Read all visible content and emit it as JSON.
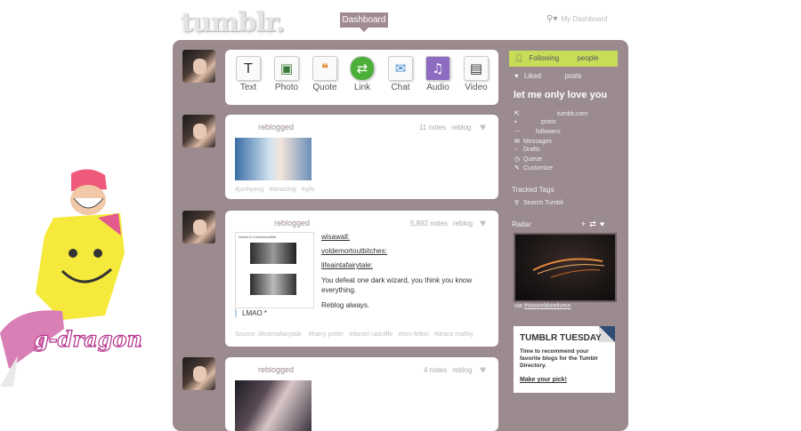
{
  "header": {
    "logo": "tumblr.",
    "nav_dashboard": "Dashboard",
    "search_label": "My Dashboard",
    "search_icon": "search-icon"
  },
  "decoration": {
    "signature_text": "g-dragon"
  },
  "composer": {
    "types": [
      {
        "label": "Text",
        "icon": "T"
      },
      {
        "label": "Photo",
        "icon": "▣"
      },
      {
        "label": "Quote",
        "icon": "❝"
      },
      {
        "label": "Link",
        "icon": "⇄"
      },
      {
        "label": "Chat",
        "icon": "✉"
      },
      {
        "label": "Audio",
        "icon": "♫"
      },
      {
        "label": "Video",
        "icon": "▤"
      }
    ]
  },
  "posts": [
    {
      "status": "reblogged",
      "notes": "11 notes",
      "reblog": "reblog",
      "tags": [
        "#junhyung",
        "#amazing",
        "#gifs"
      ]
    },
    {
      "status": "reblogged",
      "notes": "5,892 notes",
      "reblog": "reblog",
      "thumb_caption": "Daniel in Cinemacotebit",
      "chain": [
        "wisawall:",
        "voldemortoutbitches:",
        "lifeaintafairytale:"
      ],
      "quote": "You defeat one dark wizard, you think you know everything.",
      "reply": "Reblog always.",
      "comment": "LMAO *",
      "source_label": "Source:",
      "source_value": "lifeaintafairytale",
      "tags": [
        "#harry potter",
        "#daniel radcliffe",
        "#tom felton",
        "#draco malfoy"
      ]
    },
    {
      "status": "reblogged",
      "notes": "4 notes",
      "reblog": "reblog"
    }
  ],
  "sidebar": {
    "following_label": "Following",
    "following_unit": "people",
    "liked_label": "Liked",
    "liked_unit": "posts",
    "blog_title": "let me only love you",
    "blog_links": [
      {
        "icon": "⇱",
        "label": "tumblr.com"
      },
      {
        "icon": "▪",
        "label": "posts"
      },
      {
        "icon": "⋯",
        "label": "followers"
      },
      {
        "icon": "✉",
        "label": "Messages"
      },
      {
        "icon": "▫",
        "label": "Drafts"
      },
      {
        "icon": "◷",
        "label": "Queue"
      },
      {
        "icon": "✎",
        "label": "Customize"
      }
    ],
    "tracked_tags_title": "Tracked Tags",
    "search_tumblr": "Search Tumblr",
    "radar_title": "Radar",
    "radar_via": "via",
    "radar_source": "thisworldwelivein",
    "promo": {
      "title": "TUMBLR TUESDAY",
      "body": "Time to recommend your favorite blogs for the Tumblr Directory.",
      "link": "Make your pick!"
    }
  },
  "colors": {
    "panel": "#9b8b8e",
    "accent_following": "#c7dd57",
    "nav_dashboard": "#a08b91"
  }
}
